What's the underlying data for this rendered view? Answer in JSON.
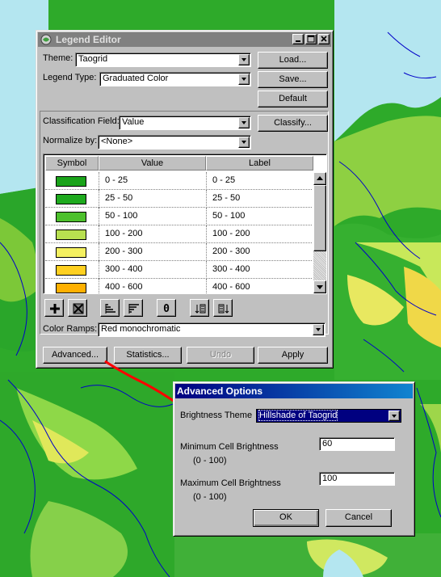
{
  "legend_editor": {
    "title": "Legend Editor",
    "theme_label": "Theme:",
    "theme_value": "Taogrid",
    "legend_type_label": "Legend Type:",
    "legend_type_value": "Graduated Color",
    "load_button": "Load...",
    "save_button": "Save...",
    "default_button": "Default",
    "classification_field_label": "Classification Field:",
    "classification_field_value": "Value",
    "classify_button": "Classify...",
    "normalize_label": "Normalize by:",
    "normalize_value": "<None>",
    "columns": [
      "Symbol",
      "Value",
      "Label"
    ],
    "rows": [
      {
        "color": "#1aa31a",
        "value": "0 - 25",
        "label": "0 - 25"
      },
      {
        "color": "#1eaa1e",
        "value": "25 - 50",
        "label": "25 - 50"
      },
      {
        "color": "#4cc02c",
        "value": "50 - 100",
        "label": "50 - 100"
      },
      {
        "color": "#b8e050",
        "value": "100 - 200",
        "label": "100 - 200"
      },
      {
        "color": "#f4f060",
        "value": "200 - 300",
        "label": "200 - 300"
      },
      {
        "color": "#ffd020",
        "value": "300 - 400",
        "label": "300 - 400"
      },
      {
        "color": "#ffb000",
        "value": "400 - 600",
        "label": "400 - 600"
      }
    ],
    "tool_zero": "0",
    "color_ramps_label": "Color Ramps:",
    "color_ramps_value": "Red monochromatic",
    "advanced_button": "Advanced...",
    "statistics_button": "Statistics...",
    "undo_button": "Undo",
    "apply_button": "Apply"
  },
  "advanced_options": {
    "title": "Advanced Options",
    "brightness_theme_label": "Brightness Theme",
    "brightness_theme_value": "Hillshade of Taogrid",
    "min_label": "Minimum Cell Brightness",
    "min_range": "(0 - 100)",
    "min_value": "60",
    "max_label": "Maximum  Cell Brightness",
    "max_range": "(0 - 100)",
    "max_value": "100",
    "ok_button": "OK",
    "cancel_button": "Cancel"
  },
  "colors": {
    "sea": "#b4e6f0",
    "lowland": "#20a020",
    "hills": "#9ed64a",
    "highland": "#f0e850",
    "arrow": "#ff0000",
    "rivers": "#0000c8"
  }
}
